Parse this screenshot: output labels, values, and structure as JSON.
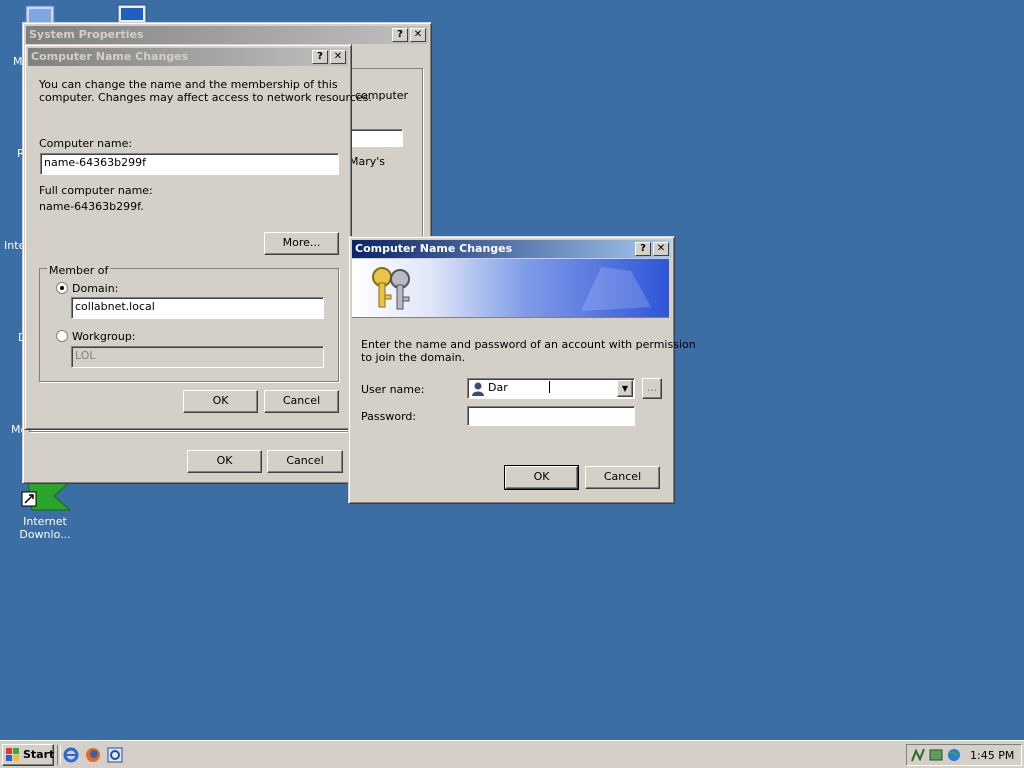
{
  "desktop": {
    "icons": [
      {
        "label": "Internet\nDownlo..."
      }
    ],
    "edge_labels": [
      "M",
      "R",
      "Inte",
      "D",
      "Mo"
    ]
  },
  "system_properties": {
    "title": "System Properties",
    "help_btn": "?",
    "close_btn": "✕",
    "visible_text_1": "computer",
    "visible_text_2": "Mary's",
    "ok_label": "OK",
    "cancel_label": "Cancel"
  },
  "name_changes_back": {
    "title": "Computer Name Changes",
    "help_btn": "?",
    "close_btn": "✕",
    "intro": "You can change the name and the membership of this\ncomputer. Changes may affect access to network resources.",
    "computer_name_label": "Computer name:",
    "computer_name_value": "name-64363b299f",
    "full_name_label": "Full computer name:",
    "full_name_value": "name-64363b299f.",
    "more_label": "More...",
    "member_of_label": "Member of",
    "domain_label": "Domain:",
    "domain_value": "collabnet.local",
    "workgroup_label": "Workgroup:",
    "workgroup_value": "LOL",
    "ok_label": "OK",
    "cancel_label": "Cancel"
  },
  "credentials_dialog": {
    "title": "Computer Name Changes",
    "help_btn": "?",
    "close_btn": "✕",
    "prompt": "Enter the name and password of an account with permission\nto join the domain.",
    "username_label": "User name:",
    "username_value": "Dar",
    "password_label": "Password:",
    "password_value": "",
    "browse_label": "...",
    "ok_label": "OK",
    "cancel_label": "Cancel"
  },
  "taskbar": {
    "start_label": "Start",
    "clock": "1:45 PM"
  }
}
